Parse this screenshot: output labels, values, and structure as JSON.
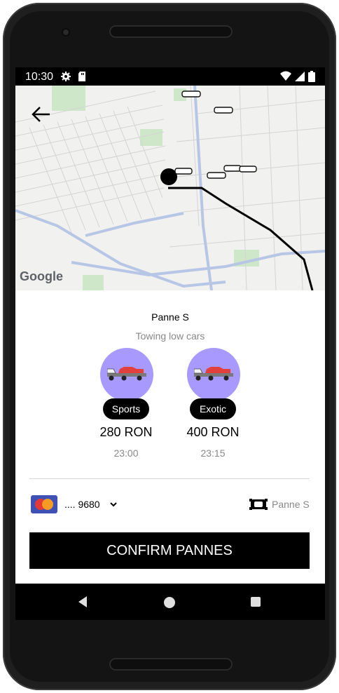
{
  "status_bar": {
    "time": "10:30"
  },
  "map": {
    "attribution": "Google"
  },
  "service": {
    "title": "Panne S",
    "subtitle": "Towing low cars"
  },
  "options": [
    {
      "name": "Sports",
      "price": "280 RON",
      "time": "23:00"
    },
    {
      "name": "Exotic",
      "price": "400 RON",
      "time": "23:15"
    }
  ],
  "payment": {
    "card_number": ".... 9680"
  },
  "vehicle": {
    "label": "Panne S"
  },
  "confirm": {
    "label": "CONFIRM PANNES"
  },
  "colors": {
    "accent": "#A899FF",
    "button": "#000000",
    "map_route": "#000000"
  },
  "icons": [
    "settings-icon",
    "sdcard-icon",
    "wifi-icon",
    "signal-icon",
    "battery-icon",
    "back-arrow-icon",
    "car-marker-icon",
    "location-pin-icon",
    "tow-truck-icon",
    "mastercard-icon",
    "chevron-down-icon",
    "vehicle-icon",
    "nav-back-icon",
    "nav-home-icon",
    "nav-recent-icon"
  ]
}
